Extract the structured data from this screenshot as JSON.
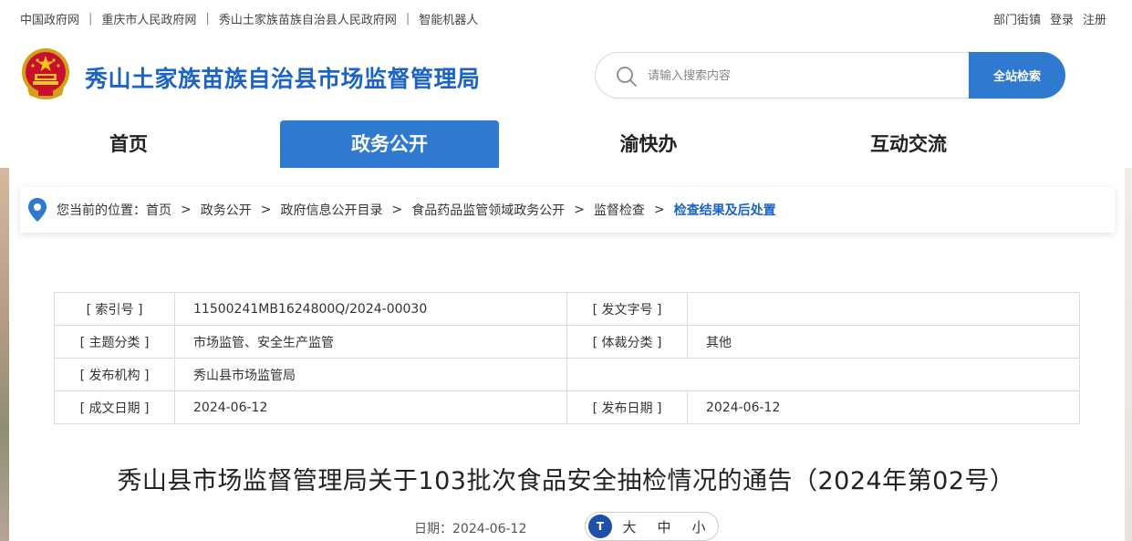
{
  "top_links": [
    "中国政府网",
    "重庆市人民政府网",
    "秀山土家族苗族自治县人民政府网",
    "智能机器人"
  ],
  "top_sep": "|",
  "user_links": [
    "部门街镇",
    "登录",
    "注册"
  ],
  "site_title": "秀山土家族苗族自治县市场监督管理局",
  "search": {
    "placeholder": "请输入搜索内容",
    "button": "全站检索"
  },
  "nav": [
    "首页",
    "政务公开",
    "渝快办",
    "互动交流"
  ],
  "nav_active": "政务公开",
  "breadcrumb": {
    "prefix": "您当前的位置：",
    "items": [
      "首页",
      "政务公开",
      "政府信息公开目录",
      "食品药品监管领域政务公开",
      "监督检查",
      "检查结果及后处置"
    ],
    "sep": ">"
  },
  "info": {
    "index_label": "[ 索引号 ]",
    "index_value": "11500241MB1624800Q/2024-00030",
    "doc_no_label": "[ 发文字号 ]",
    "doc_no_value": "",
    "topic_label": "[ 主题分类 ]",
    "topic_value": "市场监管、安全生产监管",
    "genre_label": "[ 体裁分类 ]",
    "genre_value": "其他",
    "org_label": "[ 发布机构 ]",
    "org_value": "秀山县市场监管局",
    "written_label": "[ 成文日期 ]",
    "written_value": "2024-06-12",
    "publish_label": "[ 发布日期 ]",
    "publish_value": "2024-06-12"
  },
  "article": {
    "title": "秀山县市场监督管理局关于103批次食品安全抽检情况的通告（2024年第02号）",
    "date_label": "日期：2024-06-12",
    "font_sizes": [
      "大",
      "中",
      "小"
    ],
    "tt_label": "T"
  },
  "colors": {
    "brand": "#1b63c6",
    "accent": "#2f7ad0"
  }
}
